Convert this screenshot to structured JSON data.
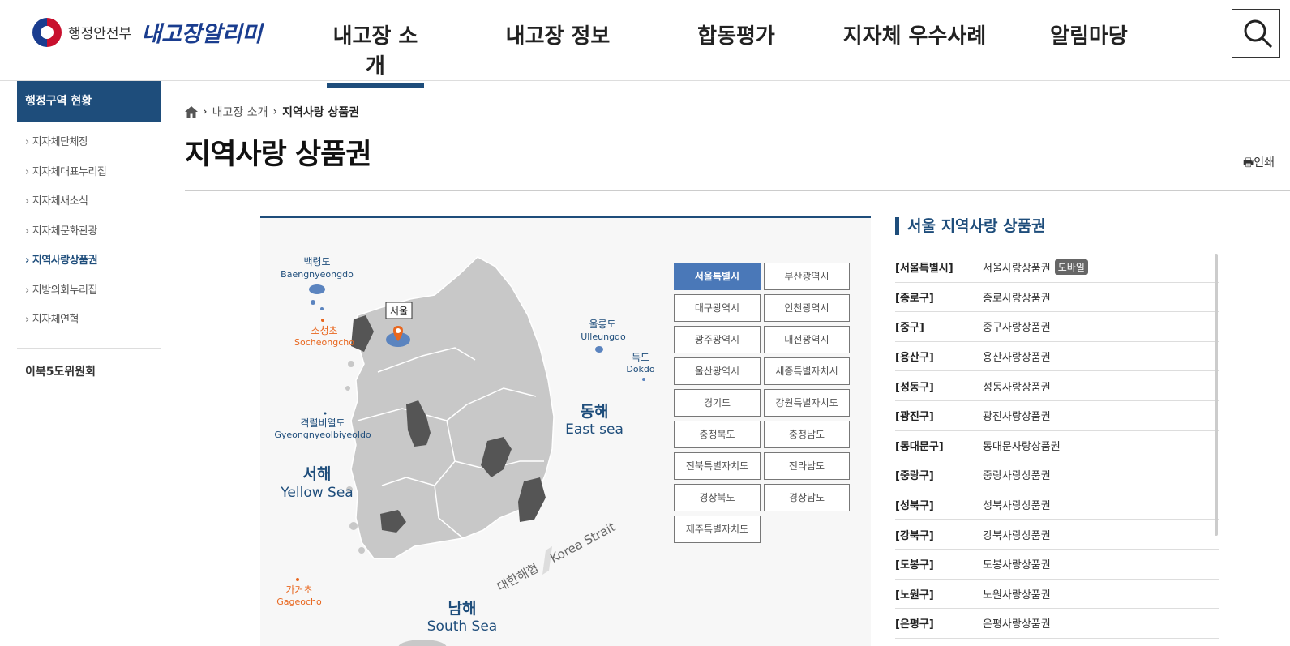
{
  "header": {
    "ministry": "행정안전부",
    "service_name": "내고장알리미",
    "nav": [
      "내고장 소개",
      "내고장 정보",
      "합동평가",
      "지자체 우수사례",
      "알림마당"
    ],
    "active_nav": "내고장 소개",
    "search_icon": "search-icon"
  },
  "sidebar": {
    "title": "행정구역 현황",
    "items": [
      "지자체단체장",
      "지자체대표누리집",
      "지자체새소식",
      "지자체문화관광",
      "지역사랑상품권",
      "지방의회누리집",
      "지자체연혁"
    ],
    "active_item": "지역사랑상품권",
    "extra": "이북5도위원회"
  },
  "breadcrumb": {
    "home_icon": "home-icon",
    "items": [
      "내고장 소개",
      "지역사랑 상품권"
    ]
  },
  "page_title": "지역사랑 상품권",
  "print_label": "인쇄",
  "map": {
    "labels": {
      "baengnyeongdo_ko": "백령도",
      "baengnyeongdo_en": "Baengnyeongdo",
      "socheongcho_ko": "소청초",
      "socheongcho_en": "Socheongcho",
      "gyeongnyeolbiyeoldo_ko": "격렬비열도",
      "gyeongnyeolbiyeoldo_en": "Gyeongnyeolbiyeoldo",
      "west_sea_ko": "서해",
      "west_sea_en": "Yellow Sea",
      "gageocho_ko": "가거초",
      "gageocho_en": "Gageocho",
      "ulleungdo_ko": "울릉도",
      "ulleungdo_en": "Ulleungdo",
      "dokdo_ko": "독도",
      "dokdo_en": "Dokdo",
      "east_sea_ko": "동해",
      "east_sea_en": "East sea",
      "korea_strait_ko": "대한해협",
      "korea_strait_en": "Korea Strait",
      "south_sea_ko": "남해",
      "south_sea_en": "South Sea",
      "seoul_marker": "서울"
    },
    "colors": {
      "land": "#c8c8c8",
      "highlight": "#5b84bf",
      "dark_region": "#555555",
      "marker": "#e8671f"
    },
    "regions": [
      "서울특별시",
      "부산광역시",
      "대구광역시",
      "인천광역시",
      "광주광역시",
      "대전광역시",
      "울산광역시",
      "세종특별자치시",
      "경기도",
      "강원특별자치도",
      "충청북도",
      "충청남도",
      "전북특별자치도",
      "전라남도",
      "경상북도",
      "경상남도",
      "제주특별자치도"
    ],
    "active_region": "서울특별시"
  },
  "list": {
    "heading": "서울 지역사랑 상품권",
    "rows": [
      {
        "district": "[서울특별시]",
        "voucher": "서울사랑상품권",
        "badge": "모바일"
      },
      {
        "district": "[종로구]",
        "voucher": "종로사랑상품권",
        "badge": ""
      },
      {
        "district": "[중구]",
        "voucher": "중구사랑상품권",
        "badge": ""
      },
      {
        "district": "[용산구]",
        "voucher": "용산사랑상품권",
        "badge": ""
      },
      {
        "district": "[성동구]",
        "voucher": "성동사랑상품권",
        "badge": ""
      },
      {
        "district": "[광진구]",
        "voucher": "광진사랑상품권",
        "badge": ""
      },
      {
        "district": "[동대문구]",
        "voucher": "동대문사랑상품권",
        "badge": ""
      },
      {
        "district": "[중랑구]",
        "voucher": "중랑사랑상품권",
        "badge": ""
      },
      {
        "district": "[성북구]",
        "voucher": "성북사랑상품권",
        "badge": ""
      },
      {
        "district": "[강북구]",
        "voucher": "강북사랑상품권",
        "badge": ""
      },
      {
        "district": "[도봉구]",
        "voucher": "도봉사랑상품권",
        "badge": ""
      },
      {
        "district": "[노원구]",
        "voucher": "노원사랑상품권",
        "badge": ""
      },
      {
        "district": "[은평구]",
        "voucher": "은평사랑상품권",
        "badge": ""
      }
    ]
  }
}
